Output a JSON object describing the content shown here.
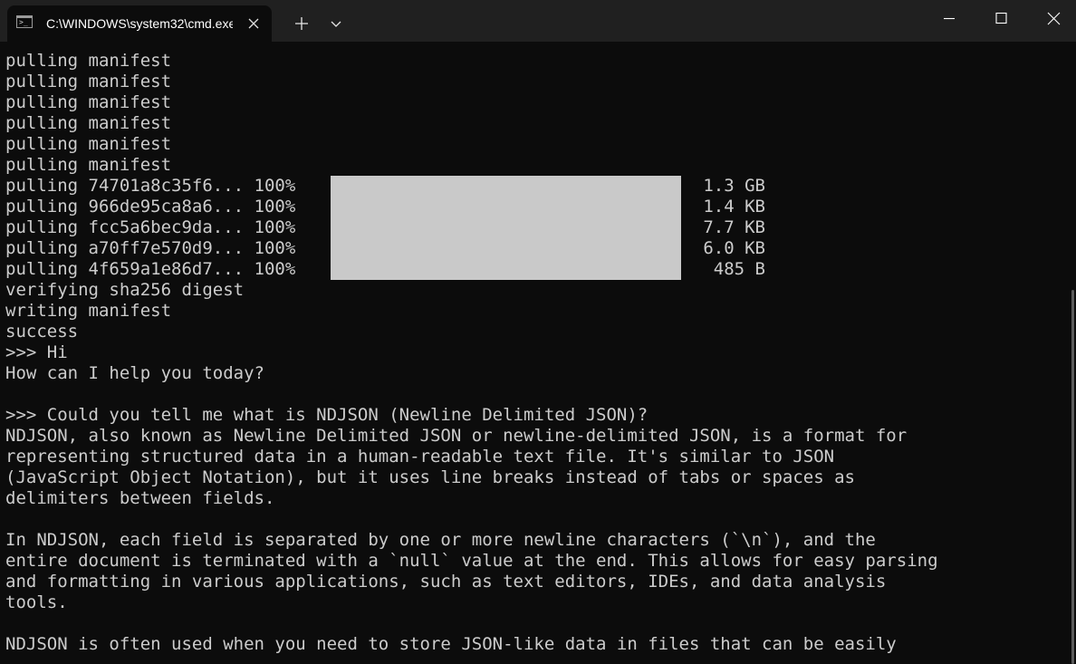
{
  "window": {
    "tab_title": "C:\\WINDOWS\\system32\\cmd.exe",
    "tab_icon": "terminal-icon",
    "controls": [
      "new-tab",
      "tab-dropdown",
      "minimize",
      "maximize",
      "close"
    ]
  },
  "terminal": {
    "lines": [
      "pulling manifest",
      "pulling manifest",
      "pulling manifest",
      "pulling manifest",
      "pulling manifest",
      "pulling manifest",
      "pulling 74701a8c35f6... 100%",
      "pulling 966de95ca8a6... 100%",
      "pulling fcc5a6bec9da... 100%",
      "pulling a70ff7e570d9... 100%",
      "pulling 4f659a1e86d7... 100%",
      "verifying sha256 digest",
      "writing manifest",
      "success",
      ">>> Hi",
      "How can I help you today?",
      "",
      ">>> Could you tell me what is NDJSON (Newline Delimited JSON)?",
      "NDJSON, also known as Newline Delimited JSON or newline-delimited JSON, is a format for",
      "representing structured data in a human-readable text file. It's similar to JSON",
      "(JavaScript Object Notation), but it uses line breaks instead of tabs or spaces as",
      "delimiters between fields.",
      "",
      "In NDJSON, each field is separated by one or more newline characters (`\\n`), and the",
      "entire document is terminated with a `null` value at the end. This allows for easy parsing",
      "and formatting in various applications, such as text editors, IDEs, and data analysis",
      "tools.",
      "",
      "NDJSON is often used when you need to store JSON-like data in files that can be easily"
    ],
    "downloads": [
      {
        "size": "1.3 GB",
        "progress": 1.0
      },
      {
        "size": "1.4 KB",
        "progress": 1.0
      },
      {
        "size": "7.7 KB",
        "progress": 1.0
      },
      {
        "size": "6.0 KB",
        "progress": 1.0
      },
      {
        "size": "485 B",
        "progress": 1.0
      }
    ],
    "colors": {
      "background": "#0c0c0c",
      "foreground": "#cccccc",
      "progress_fill": "#c9c9c9"
    }
  }
}
